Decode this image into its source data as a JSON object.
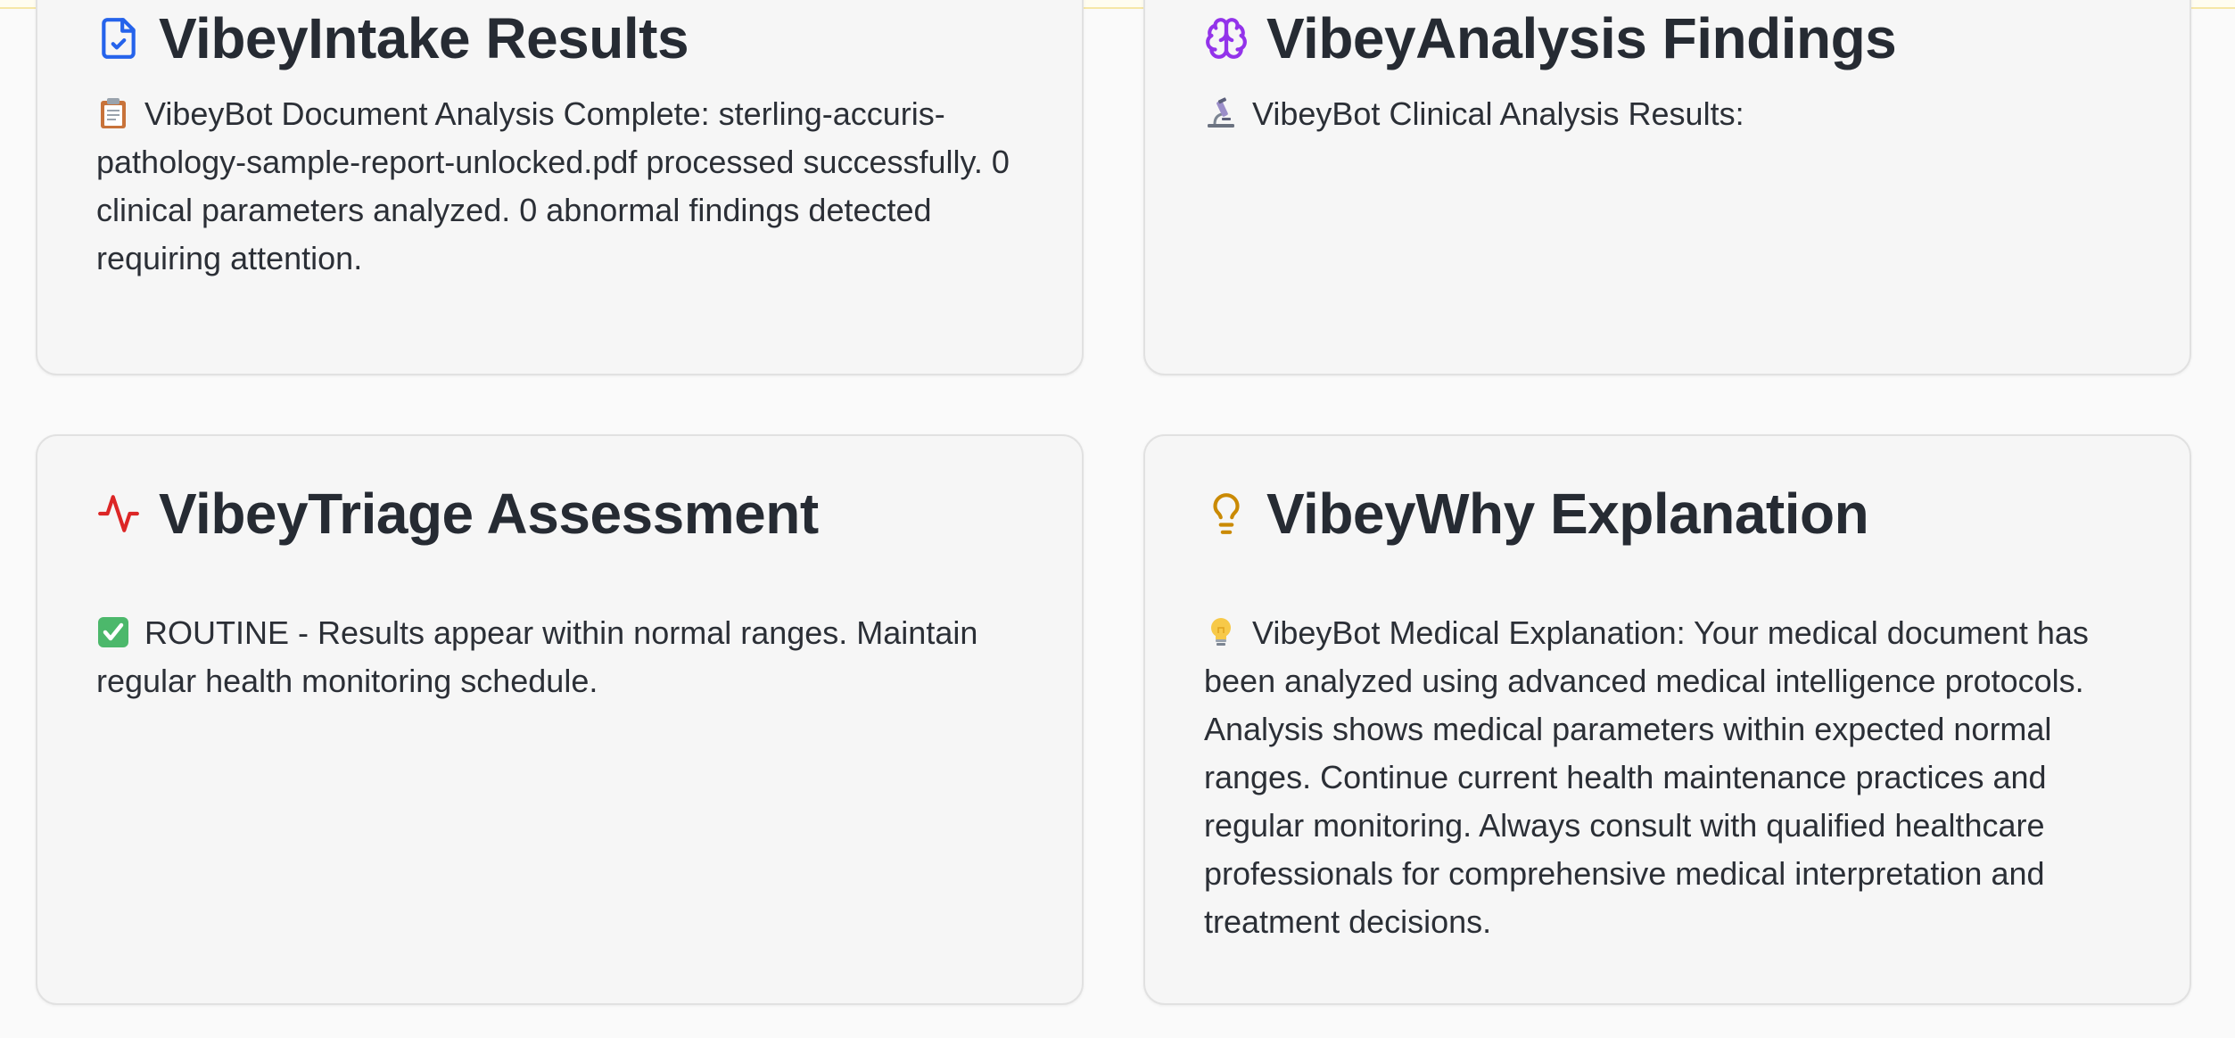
{
  "cards": {
    "intake": {
      "title": "VibeyIntake Results",
      "icon": "file-check-icon",
      "icon_color": "#2563eb",
      "body_icon": "clipboard-icon",
      "body": "VibeyBot Document Analysis Complete: sterling-accuris-pathology-sample-report-unlocked.pdf processed successfully. 0 clinical parameters analyzed. 0 abnormal findings detected requiring attention."
    },
    "analysis": {
      "title": "VibeyAnalysis Findings",
      "icon": "brain-icon",
      "icon_color": "#9333ea",
      "body_icon": "microscope-icon",
      "body": "VibeyBot Clinical Analysis Results:"
    },
    "triage": {
      "title": "VibeyTriage Assessment",
      "icon": "activity-icon",
      "icon_color": "#dc2626",
      "body_icon": "check-mark-button-icon",
      "body": "ROUTINE - Results appear within normal ranges. Maintain regular health monitoring schedule."
    },
    "why": {
      "title": "VibeyWhy Explanation",
      "icon": "lightbulb-icon",
      "icon_color": "#ca8a04",
      "body_icon": "lightbulb-emoji-icon",
      "body": "VibeyBot Medical Explanation: Your medical document has been analyzed using advanced medical intelligence protocols. Analysis shows medical parameters within expected normal ranges. Continue current health maintenance practices and regular monitoring. Always consult with qualified healthcare professionals for comprehensive medical interpretation and treatment decisions."
    }
  }
}
